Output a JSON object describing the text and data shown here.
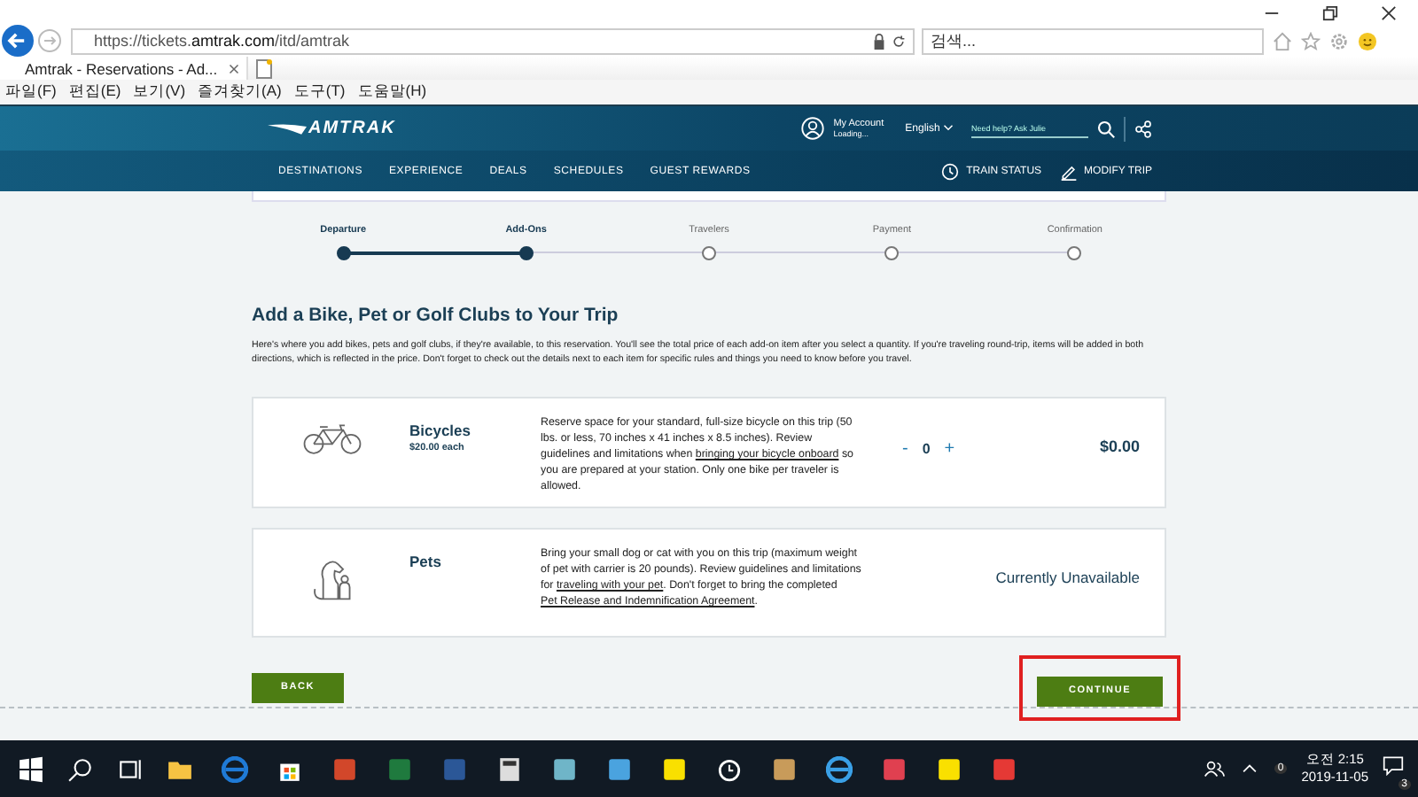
{
  "browser": {
    "url": "https://tickets.**amtrak.com**/itd/amtrak",
    "search_placeholder": "검색...",
    "tab_title": "Amtrak - Reservations - Ad...",
    "menu": [
      "파일(F)",
      "편집(E)",
      "보기(V)",
      "즐겨찾기(A)",
      "도구(T)",
      "도움말(H)"
    ]
  },
  "header": {
    "logo": "AMTRAK",
    "account": "My Account",
    "account_status": "Loading...",
    "language": "English",
    "help_placeholder": "Need help? Ask Julie",
    "nav": [
      "DESTINATIONS",
      "EXPERIENCE",
      "DEALS",
      "SCHEDULES",
      "GUEST REWARDS"
    ],
    "actions": [
      {
        "kind": "clock",
        "label": "TRAIN STATUS"
      },
      {
        "kind": "pencil",
        "label": "MODIFY TRIP"
      }
    ]
  },
  "steps": [
    {
      "label": "Departure",
      "reached": true
    },
    {
      "label": "Add-Ons",
      "reached": true
    },
    {
      "label": "Travelers",
      "reached": false
    },
    {
      "label": "Payment",
      "reached": false
    },
    {
      "label": "Confirmation",
      "reached": false
    }
  ],
  "heading": "Add a Bike, Pet or Golf Clubs to Your Trip",
  "intro": "Here's where you add bikes, pets and golf clubs, if they're available, to this reservation. You'll see the total price of each add-on item after you select a quantity. If you're traveling round-trip, items will be added in both directions, which is reflected in the price. Don't forget to check out the details next to each item for specific rules and things you need to know before you travel.",
  "addons": [
    {
      "kind": "bicycle",
      "name": "Bicycles",
      "price": "$20.00 each",
      "description": [
        {
          "text": "Reserve space for your standard, full-size bicycle on this trip (50 lbs. or less, 70 inches x 41 inches x 8.5 inches). Review guidelines and limitations when "
        },
        {
          "text": "bringing your bicycle onboard",
          "link": true
        },
        {
          "text": " so you are prepared at your station. Only one bike per traveler is allowed."
        }
      ],
      "available": true,
      "minus": "-",
      "quantity": "0",
      "plus": "+",
      "total": "$0.00"
    },
    {
      "kind": "pet",
      "name": "Pets",
      "description": [
        {
          "text": "Bring your small dog or cat with you on this trip (maximum weight of pet with carrier is 20 pounds). Review guidelines and limitations for "
        },
        {
          "text": "traveling with your pet",
          "link": true
        },
        {
          "text": ". Don't forget to bring the completed "
        },
        {
          "text": "Pet Release and Indemnification Agreement",
          "link": true
        },
        {
          "text": "."
        }
      ],
      "available": false,
      "status": "Currently Unavailable"
    }
  ],
  "buttons": {
    "back": "BACK",
    "continue": "CONTINUE",
    "continue_highlighted": true
  },
  "taskbar": {
    "time": "오전 2:15",
    "date": "2019-11-05",
    "notifications": "3",
    "alarm_badge": "0"
  }
}
